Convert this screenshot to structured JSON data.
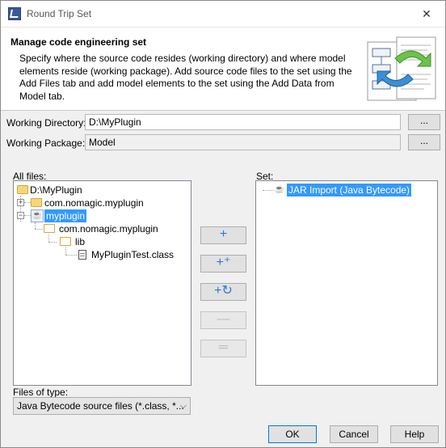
{
  "window": {
    "title": "Round Trip Set",
    "close_glyph": "✕"
  },
  "header": {
    "title": "Manage code engineering set",
    "description": "Specify where the source code resides (working directory) and where model elements reside (working package). Add source code files to the set using the Add Files tab and add model elements to the set using the Add Data from Model tab."
  },
  "working_directory": {
    "label": "Working Directory:",
    "value": "D:\\MyPlugin",
    "browse_label": "..."
  },
  "working_package": {
    "label": "Working Package:",
    "value": "Model",
    "browse_label": "..."
  },
  "all_files": {
    "label": "All files:",
    "nodes": [
      {
        "label": "D:\\MyPlugin",
        "icon": "folder-icon"
      },
      {
        "label": "com.nomagic.myplugin",
        "icon": "folder-icon",
        "expander": "+"
      },
      {
        "label": "myplugin",
        "icon": "java-project-icon",
        "expander": "−",
        "selected": true
      },
      {
        "label": "com.nomagic.myplugin",
        "icon": "folder-open-icon"
      },
      {
        "label": "lib",
        "icon": "folder-open-icon"
      },
      {
        "label": "MyPluginTest.class",
        "icon": "class-file-icon"
      }
    ]
  },
  "set": {
    "label": "Set:",
    "nodes": [
      {
        "label": "JAR Import (Java Bytecode)",
        "icon": "jar-icon",
        "selected": true
      }
    ]
  },
  "side_buttons": [
    {
      "name": "add-button",
      "glyph": "+",
      "enabled": true
    },
    {
      "name": "add-all-button",
      "glyph": "+⁺",
      "enabled": true
    },
    {
      "name": "add-recursive-button",
      "glyph": "+↻",
      "enabled": true
    },
    {
      "name": "remove-button",
      "glyph": "—",
      "enabled": false
    },
    {
      "name": "remove-all-button",
      "glyph": "═",
      "enabled": false
    }
  ],
  "files_of_type": {
    "label": "Files of type:",
    "value": "Java Bytecode source files (*.class, *..."
  },
  "footer": {
    "ok": "OK",
    "cancel": "Cancel",
    "help": "Help"
  },
  "colors": {
    "selection": "#3399ff",
    "accent": "#2a7ad5"
  }
}
